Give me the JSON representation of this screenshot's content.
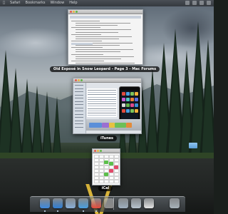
{
  "menubar": {
    "items": [
      "Safari",
      "Bookmarks",
      "Window",
      "Help"
    ],
    "extras": [
      "wifi-icon",
      "volume-icon",
      "clock-icon",
      "spotlight-icon"
    ]
  },
  "windows": {
    "forum": {
      "label": "Old Exposé in Snow Leopard - Page 3 - Mac Forums",
      "app": "Safari"
    },
    "itunes": {
      "label": "iTunes",
      "app": "iTunes"
    },
    "ical": {
      "label": "iCal",
      "app": "iCal"
    }
  },
  "dock": {
    "icons": [
      {
        "name": "finder-icon",
        "color": "#3f8be0",
        "running": true
      },
      {
        "name": "safari-icon",
        "color": "#2f7fd6",
        "running": true
      },
      {
        "name": "mail-icon",
        "color": "#8ab0d9",
        "running": false
      },
      {
        "name": "itunes-icon",
        "color": "#4a9fe0",
        "running": true
      },
      {
        "name": "ical-icon",
        "color": "#e24a3c",
        "running": true
      },
      {
        "name": "system-preferences-icon",
        "color": "#8c8c8c",
        "running": false
      },
      {
        "name": "applications-folder-icon",
        "color": "#9fb0c0",
        "running": false
      },
      {
        "name": "downloads-folder-icon",
        "color": "#b8c4cf",
        "running": false
      },
      {
        "name": "documents-stack-icon",
        "color": "#e6e6e6",
        "running": false
      },
      {
        "name": "trash-icon",
        "color": "#a9b3bb",
        "running": false
      }
    ]
  },
  "colors": {
    "accent": "#3f8be0",
    "label_bg": "#000000",
    "road_line": "#d8b43a"
  }
}
